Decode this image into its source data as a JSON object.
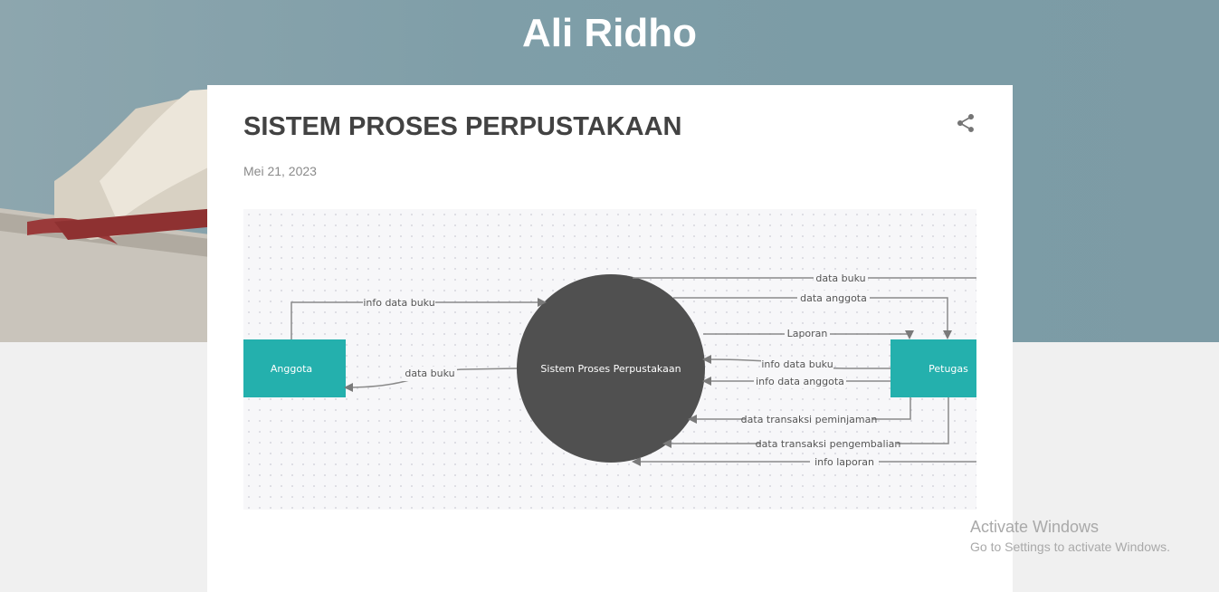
{
  "blog": {
    "title": "Ali Ridho"
  },
  "post": {
    "title": "SISTEM PROSES PERPUSTAKAAN",
    "date": "Mei 21, 2023",
    "share_icon": "share-icon"
  },
  "diagram": {
    "nodes": {
      "process": "Sistem Proses Perpustakaan",
      "entity_left": "Anggota",
      "entity_right": "Petugas"
    },
    "flows": {
      "info_data_buku_top": "info data buku",
      "data_buku_left": "data buku",
      "data_buku_top": "data buku",
      "data_anggota": "data anggota",
      "laporan": "Laporan",
      "info_data_buku_right": "info data buku",
      "info_data_anggota": "info data anggota",
      "data_transaksi_peminjaman": "data transaksi peminjaman",
      "data_transaksi_pengembalian": "data transaksi pengembalian",
      "info_laporan": "info laporan"
    },
    "colors": {
      "entity": "#24b0ad",
      "process": "#505050",
      "line": "#8a8a8a"
    }
  },
  "os_overlay": {
    "title": "Activate Windows",
    "subtitle": "Go to Settings to activate Windows."
  }
}
